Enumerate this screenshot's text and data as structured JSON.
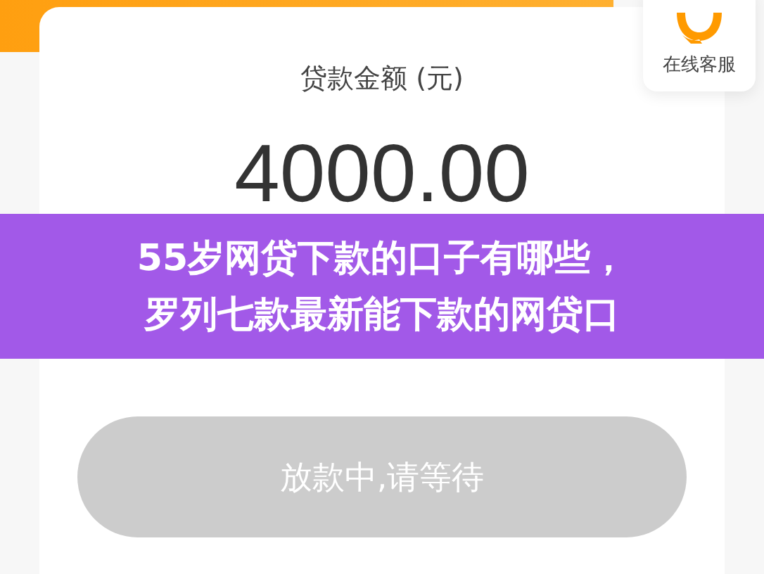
{
  "service_button": {
    "label": "在线客服"
  },
  "loan": {
    "label": "贷款金额 (元)",
    "amount": "4000.00"
  },
  "submit_button": {
    "label": "放款中,请等待",
    "disabled": true
  },
  "banner": {
    "lines": [
      "55岁网贷下款的口子有哪些，",
      "罗列七款最新能下款的网贷口"
    ]
  }
}
